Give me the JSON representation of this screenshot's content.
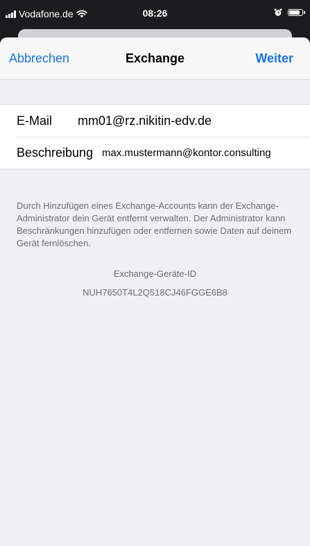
{
  "status_bar": {
    "carrier": "Vodafone.de",
    "time": "08:26",
    "icons": [
      "signal-icon",
      "wifi-icon",
      "alarm-icon",
      "battery-icon"
    ],
    "battery_level": 0.9
  },
  "navbar": {
    "cancel_label": "Abbrechen",
    "title": "Exchange",
    "next_label": "Weiter"
  },
  "form": {
    "email_label": "E-Mail",
    "email_value": "mm01@rz.nikitin-edv.de",
    "description_label": "Beschreibung",
    "description_value": "max.mustermann@kontor.consulting"
  },
  "footer": {
    "info_text": "Durch Hinzufügen eines Exchange-Accounts kann der Exchange-Administrator dein Gerät entfernt verwalten. Der Administrator kann Beschränkungen hinzufügen oder entfernen sowie Daten auf deinem Gerät fernlöschen.",
    "device_id_label": "Exchange-Geräte-ID",
    "device_id_value": "NUH7650T4L2Q518CJ46FGGE6B8"
  },
  "colors": {
    "accent": "#1a73e8",
    "background": "#efeff4",
    "secondary_text": "#6d6d72"
  }
}
